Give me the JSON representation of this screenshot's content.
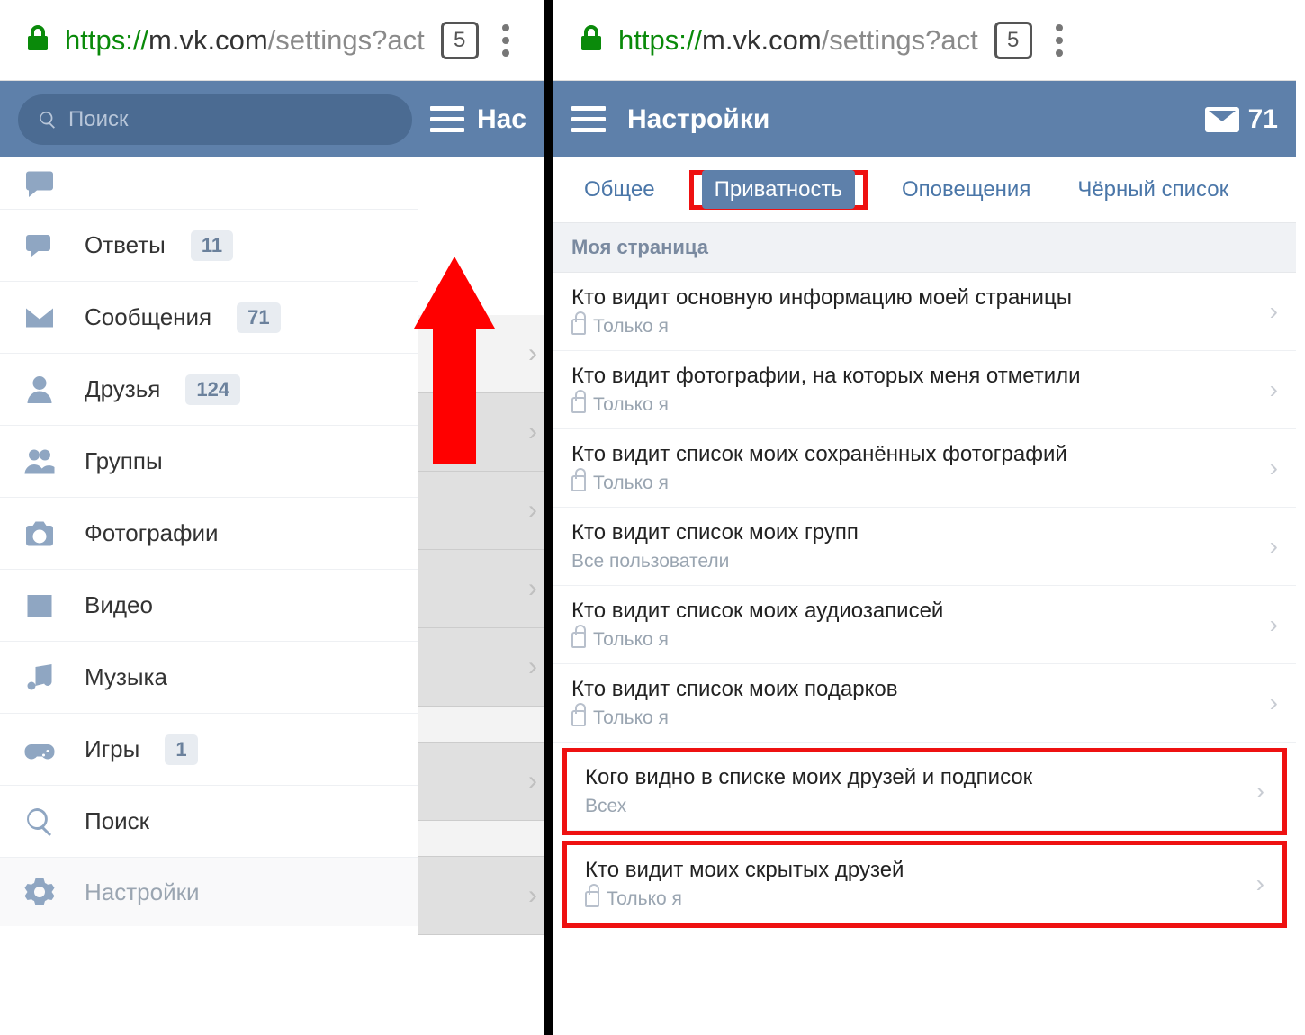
{
  "url": {
    "proto": "https://",
    "host": "m.vk.com",
    "path": "/settings?act"
  },
  "tabs_count": "5",
  "left": {
    "search_placeholder": "Поиск",
    "bb_title_partial": "Нас",
    "menu": [
      {
        "label": "Ответы",
        "badge": "11",
        "icon": "replies"
      },
      {
        "label": "Сообщения",
        "badge": "71",
        "icon": "messages"
      },
      {
        "label": "Друзья",
        "badge": "124",
        "icon": "friends"
      },
      {
        "label": "Группы",
        "badge": "",
        "icon": "groups"
      },
      {
        "label": "Фотографии",
        "badge": "",
        "icon": "photos"
      },
      {
        "label": "Видео",
        "badge": "",
        "icon": "video"
      },
      {
        "label": "Музыка",
        "badge": "",
        "icon": "music"
      },
      {
        "label": "Игры",
        "badge": "1",
        "icon": "games"
      },
      {
        "label": "Поиск",
        "badge": "",
        "icon": "search"
      }
    ],
    "settings_label": "Настройки"
  },
  "right": {
    "bb_title": "Настройки",
    "mail_count": "71",
    "tabs": {
      "general": "Общее",
      "privacy": "Приватность",
      "notif": "Оповещения",
      "black": "Чёрный список"
    },
    "section_header": "Моя страница",
    "rows": [
      {
        "title": "Кто видит основную информацию моей страницы",
        "value": "Только я",
        "locked": true,
        "highlight": false
      },
      {
        "title": "Кто видит фотографии, на которых меня отметили",
        "value": "Только я",
        "locked": true,
        "highlight": false
      },
      {
        "title": "Кто видит список моих сохранённых фотографий",
        "value": "Только я",
        "locked": true,
        "highlight": false
      },
      {
        "title": "Кто видит список моих групп",
        "value": "Все пользователи",
        "locked": false,
        "highlight": false
      },
      {
        "title": "Кто видит список моих аудиозаписей",
        "value": "Только я",
        "locked": true,
        "highlight": false
      },
      {
        "title": "Кто видит список моих подарков",
        "value": "Только я",
        "locked": true,
        "highlight": false
      },
      {
        "title": "Кого видно в списке моих друзей и подписок",
        "value": "Всех",
        "locked": false,
        "highlight": true
      },
      {
        "title": "Кто видит моих скрытых друзей",
        "value": "Только я",
        "locked": true,
        "highlight": true
      }
    ]
  }
}
